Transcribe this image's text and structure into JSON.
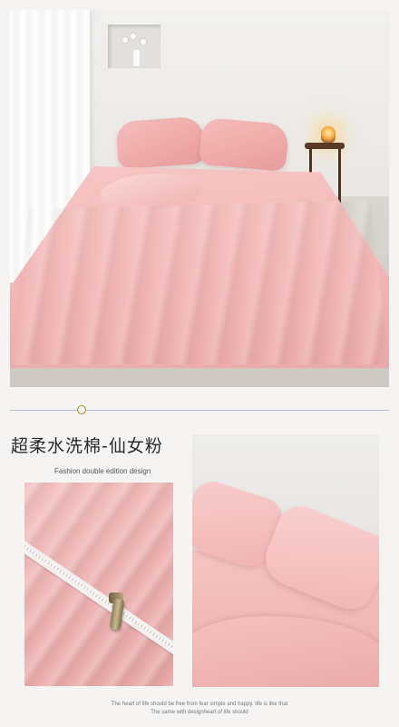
{
  "title": "超柔水洗棉-仙女粉",
  "subtitle": "Fashion double edition design",
  "footer": {
    "line1": "The heart of life should be free from fear simple and happy. life is like that",
    "line2": "The same with designheart of life should"
  },
  "colors": {
    "background": "#f6f4f3",
    "accent_line": "#bdb8e0",
    "accent_dot": "#b78a2e",
    "product_pink": "#f2b8b7"
  },
  "images": {
    "hero": "pink-bedding-room-photo",
    "detail_left": "zipper-closeup-photo",
    "detail_right": "pink-pillows-photo"
  }
}
